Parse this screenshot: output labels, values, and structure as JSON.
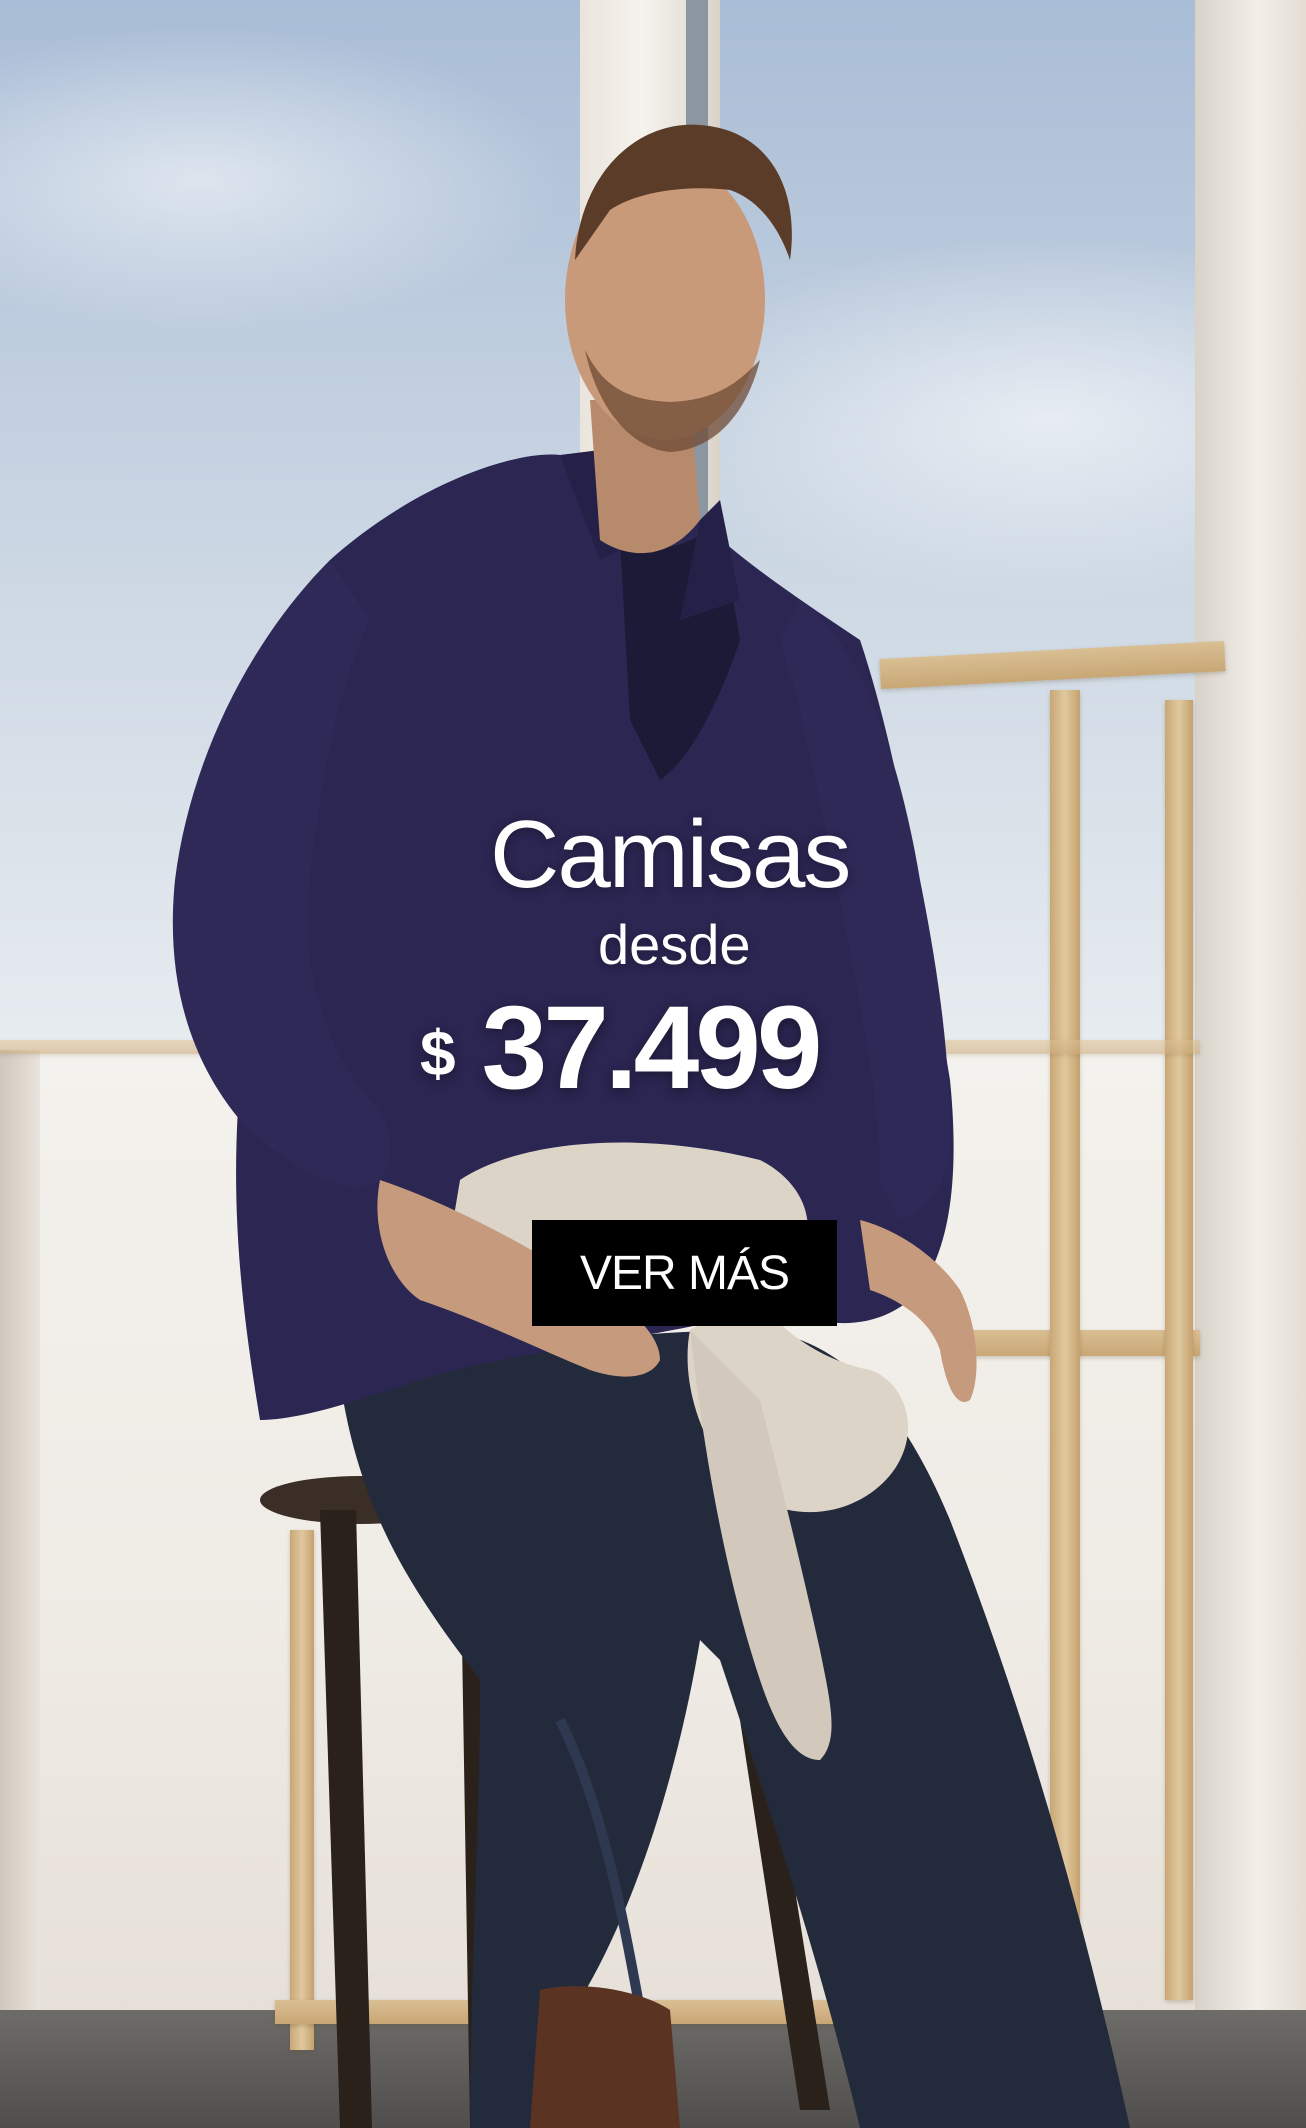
{
  "promo": {
    "title": "Camisas",
    "from_label": "desde",
    "currency": "$",
    "price": "37.499",
    "cta_label": "VER MÁS"
  },
  "hero_image": {
    "subject": "man-seated-on-stool-icon"
  },
  "colors": {
    "cta_background": "#000000",
    "cta_text": "#ffffff",
    "overlay_text": "#ffffff",
    "shirt": "#2a2550",
    "jeans": "#232a3d"
  }
}
